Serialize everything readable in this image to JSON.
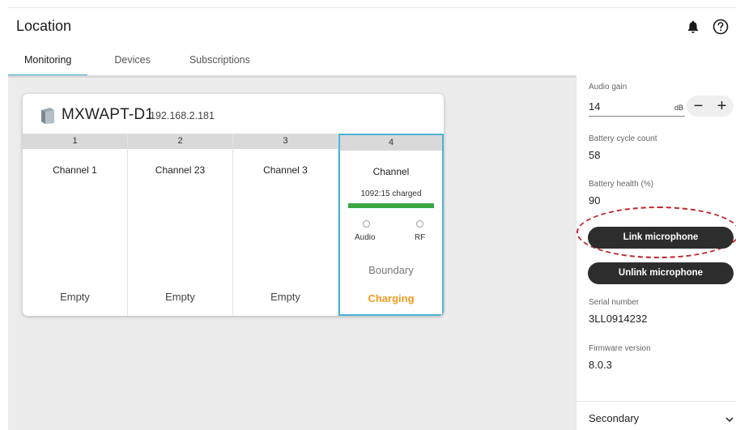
{
  "header": {
    "title": "Location",
    "bell_icon": "bell-icon",
    "help_icon": "help-icon"
  },
  "tabs": [
    {
      "label": "Monitoring",
      "active": true
    },
    {
      "label": "Devices",
      "active": false
    },
    {
      "label": "Subscriptions",
      "active": false
    }
  ],
  "device": {
    "name": "MXWAPT-D1",
    "ip": "192.168.2.181",
    "channels": [
      {
        "number": "1",
        "name": "Channel 1",
        "status": "Empty"
      },
      {
        "number": "2",
        "name": "Channel 23",
        "status": "Empty"
      },
      {
        "number": "3",
        "name": "Channel 3",
        "status": "Empty"
      },
      {
        "number": "4",
        "name": "Channel",
        "status": "Charging",
        "charge_text": "1092:15 charged",
        "audio_label": "Audio",
        "rf_label": "RF",
        "mic_type": "Boundary",
        "status_color": "#f29b1d",
        "charge_bar_color": "#39a845"
      }
    ]
  },
  "panel": {
    "audio_gain_label": "Audio gain",
    "audio_gain_value": "14",
    "audio_gain_unit": "dB",
    "minus": "−",
    "plus": "+",
    "battery_cycle_label": "Battery cycle count",
    "battery_cycle_value": "58",
    "battery_health_label": "Battery health (%)",
    "battery_health_value": "90",
    "link_button": "Link microphone",
    "unlink_button": "Unlink microphone",
    "serial_label": "Serial number",
    "serial_value": "3LL0914232",
    "firmware_label": "Firmware version",
    "firmware_value": "8.0.3",
    "secondary_label": "Secondary"
  }
}
